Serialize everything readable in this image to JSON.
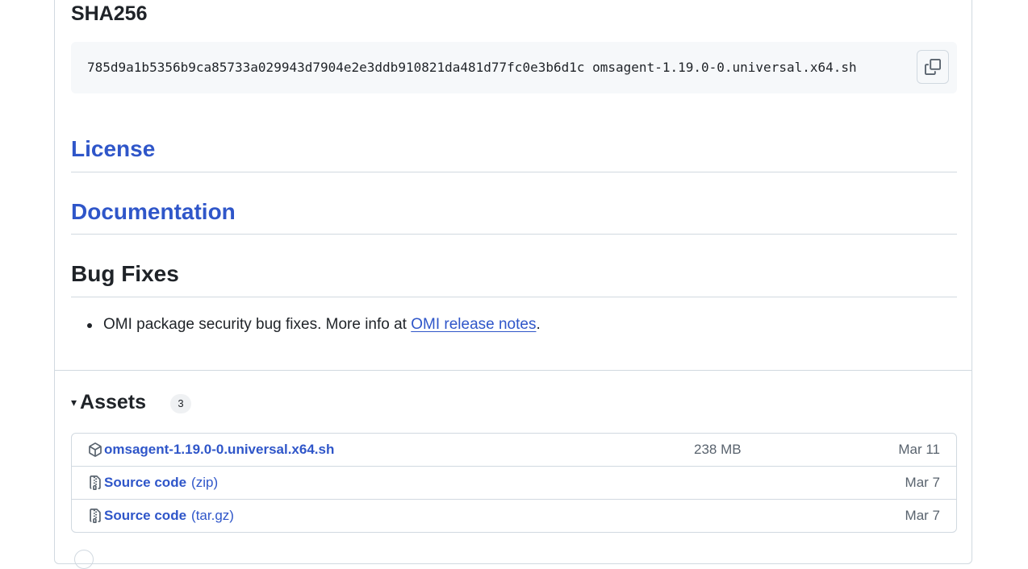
{
  "release": {
    "sha_heading": "SHA256",
    "sha_line": "785d9a1b5356b9ca85733a029943d7904e2e3ddb910821da481d77fc0e3b6d1c omsagent-1.19.0-0.universal.x64.sh",
    "copy_icon": "copy-icon",
    "license_heading": "License",
    "documentation_heading": "Documentation",
    "bug_fixes_heading": "Bug Fixes",
    "bug_fix_text": "OMI package security bug fixes. More info at ",
    "bug_fix_link": "OMI release notes",
    "bug_fix_end": "."
  },
  "assets": {
    "caret": "▾",
    "title": "Assets",
    "count": "3",
    "rows": [
      {
        "icon": "package-icon",
        "name": "omsagent-1.19.0-0.universal.x64.sh",
        "suffix": "",
        "size": "238 MB",
        "date": "Mar 11"
      },
      {
        "icon": "file-zip-icon",
        "name": "Source code",
        "suffix": "(zip)",
        "size": "",
        "date": "Mar 7"
      },
      {
        "icon": "file-zip-icon",
        "name": "Source code",
        "suffix": "(tar.gz)",
        "size": "",
        "date": "Mar 7"
      }
    ]
  },
  "colors": {
    "link": "#2f56c9",
    "text": "#1f2328",
    "muted": "#59636e",
    "border": "#d1d9e0",
    "code_bg": "#f6f8fa"
  }
}
